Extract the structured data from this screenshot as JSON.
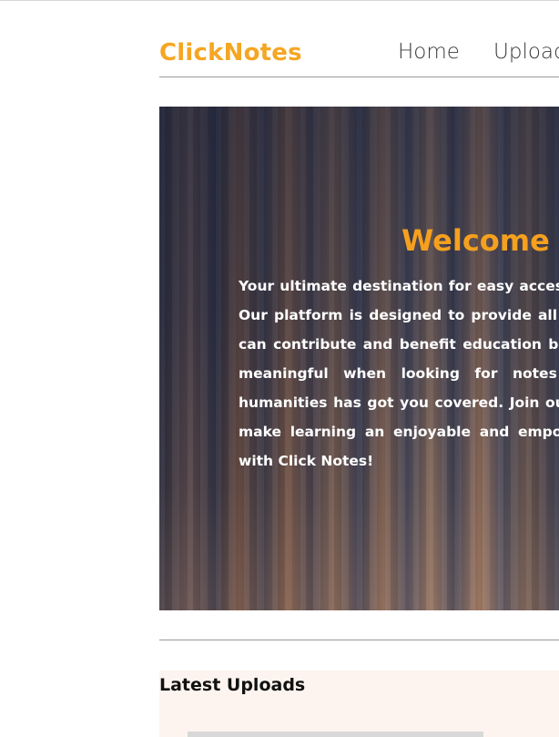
{
  "header": {
    "logo": "ClickNotes",
    "nav": [
      {
        "label": "Home"
      },
      {
        "label": "Upload"
      }
    ]
  },
  "hero": {
    "title": "Welcome t",
    "text": "Your ultimate destination for easy access to courses. Our platform is designed to provide all backgrounds can contribute and benefit education becomes more meaningful when looking for notes in science, humanities has got you covered. Join our community make learning an enjoyable and empowering learn with Click Notes!"
  },
  "latest": {
    "title": "Latest Uploads"
  },
  "colors": {
    "brand": "#f5a623",
    "hero_title": "#f5a01e",
    "latest_bg": "#fdf4ef"
  }
}
